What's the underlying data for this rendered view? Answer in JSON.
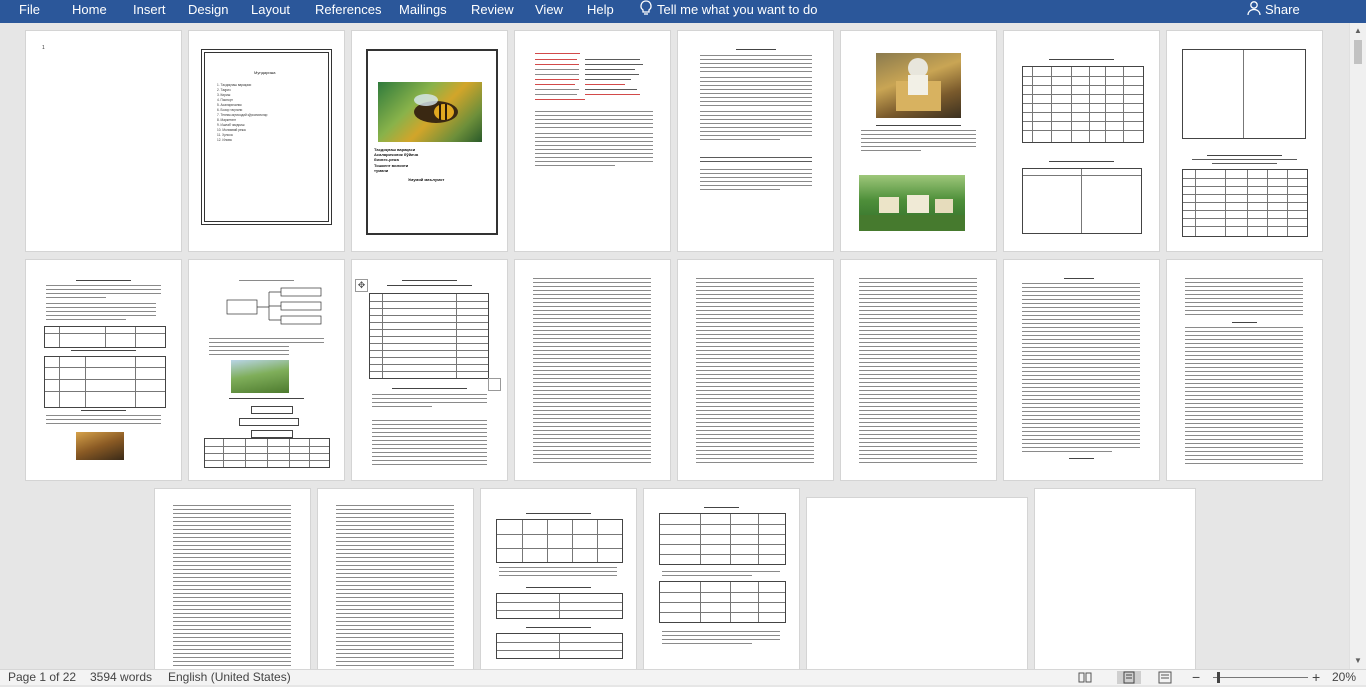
{
  "ribbon": {
    "tabs": [
      "File",
      "Home",
      "Insert",
      "Design",
      "Layout",
      "References",
      "Mailings",
      "Review",
      "View",
      "Help"
    ],
    "tell_me": "Tell me what you want to do",
    "share": "Share"
  },
  "document": {
    "page1_number": "1",
    "toc_title": "Мундарижа",
    "toc_items": [
      "1. Тасдиқлаш варақаси",
      "2. Тақриз",
      "3. Кириш",
      "4. Паспорт",
      "5. Асаларичилик",
      "6. Бозор таҳлили",
      "7. Техник-иқтисодий кўрсаткичлар",
      "8. Маркетинг",
      "9. Ишлаб чиқариш",
      "10. Молиявий режа",
      "11. Хулоса",
      "12. Илова"
    ],
    "cover_lines": [
      "Тасдиқлаш варақаси",
      "Асаларичилик бўйича",
      "бизнес-режа",
      "Тошкент вилояти",
      "тумани"
    ],
    "cover_footer": "Умумий маълумот"
  },
  "status": {
    "page": "Page 1 of 22",
    "words": "3594 words",
    "language": "English (United States)",
    "zoom_level": "20%",
    "zoom_fraction": 0.2
  },
  "colors": {
    "ribbon": "#2b579a",
    "canvas": "#e6e6e6",
    "page": "#ffffff"
  },
  "icons": {
    "tell_me": "lightbulb-icon",
    "share": "person-icon",
    "read_mode": "read-mode-icon",
    "print_layout": "print-layout-icon",
    "web_layout": "web-layout-icon",
    "zoom_out": "minus-icon",
    "zoom_in": "plus-icon"
  }
}
